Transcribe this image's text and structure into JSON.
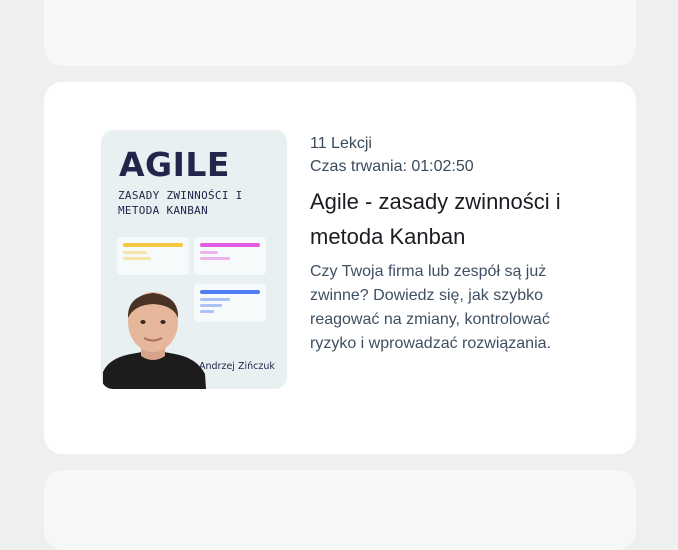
{
  "course": {
    "lessons": "11 Lekcji",
    "duration": "Czas trwania: 01:02:50",
    "title": "Agile - zasady zwinności i metoda Kanban",
    "description": "Czy Twoja firma lub zespół są już zwinne? Dowiedz się, jak szybko reagować na zmiany, kontrolować ryzyko i wprowadzać rozwiązania.",
    "thumbnail": {
      "heading": "AGILE",
      "subheading": "ZASADY ZWINNOŚCI I METODA KANBAN",
      "author": "Andrzej Zińczuk"
    }
  },
  "colors": {
    "page_background": "#eef0ef",
    "card_background": "#ffffff",
    "thumbnail_background": "#e8f0f2",
    "kanban_yellow": "#f5c842",
    "kanban_magenta": "#e35be0",
    "kanban_blue": "#4f7ef0",
    "title_text": "#1b1d22",
    "body_text": "#3e4f62"
  }
}
